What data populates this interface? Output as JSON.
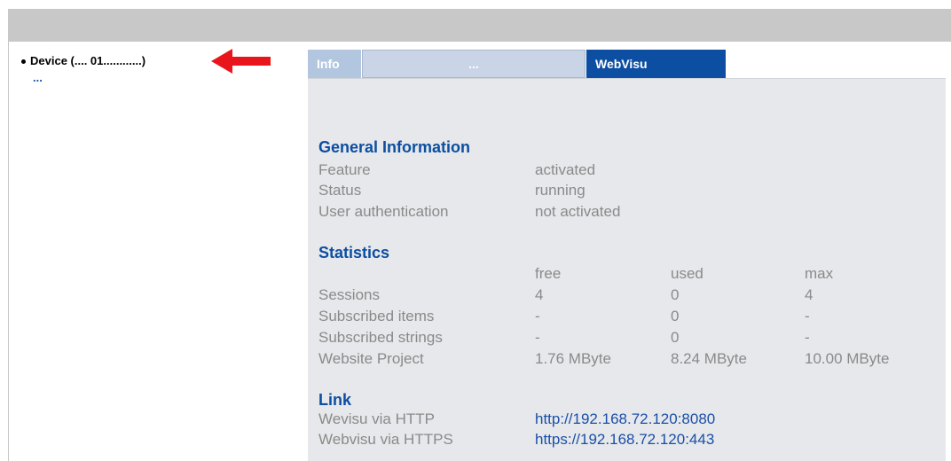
{
  "tree": {
    "device_label": "Device (.... 01............)",
    "more_label": "..."
  },
  "tabs": [
    {
      "label": "Info"
    },
    {
      "label": "..."
    },
    {
      "label": "WebVisu"
    }
  ],
  "general": {
    "title": "General Information",
    "rows": [
      {
        "label": "Feature",
        "value": "activated"
      },
      {
        "label": "Status",
        "value": "running"
      },
      {
        "label": "User authentication",
        "value": "not activated"
      }
    ]
  },
  "statistics": {
    "title": "Statistics",
    "headers": [
      "free",
      "used",
      "max"
    ],
    "rows": [
      {
        "label": "Sessions",
        "free": "4",
        "used": "0",
        "max": "4"
      },
      {
        "label": "Subscribed items",
        "free": "-",
        "used": "0",
        "max": "-"
      },
      {
        "label": "Subscribed strings",
        "free": "-",
        "used": "0",
        "max": "-"
      },
      {
        "label": "Website Project",
        "free": "1.76 MByte",
        "used": "8.24 MByte",
        "max": "10.00 MByte"
      }
    ]
  },
  "link": {
    "title": "Link",
    "rows": [
      {
        "label": "Wevisu via HTTP",
        "url": "http://192.168.72.120:8080"
      },
      {
        "label": "Webvisu via HTTPS",
        "url": "https://192.168.72.120:443"
      }
    ]
  },
  "colors": {
    "accent": "#0c4ea2",
    "arrow": "#e8161c",
    "panel": "#e6e8eb",
    "topbar": "#c8c8c8"
  }
}
